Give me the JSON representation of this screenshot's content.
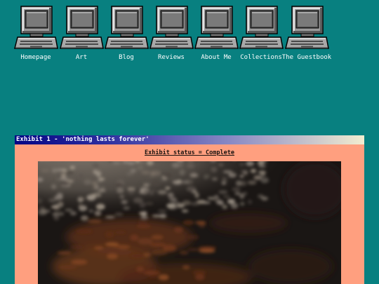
{
  "nav": {
    "items": [
      {
        "label": "Homepage",
        "icon": "computer-icon"
      },
      {
        "label": "Art",
        "icon": "computer-icon"
      },
      {
        "label": "Blog",
        "icon": "computer-icon"
      },
      {
        "label": "Reviews",
        "icon": "computer-icon"
      },
      {
        "label": "About Me",
        "icon": "computer-icon"
      },
      {
        "label": "Collections",
        "icon": "computer-icon"
      },
      {
        "label": "The Guestbook",
        "icon": "computer-icon"
      }
    ]
  },
  "exhibit": {
    "title": "Exhibit 1 - 'nothing lasts forever'",
    "status": "Exhibit status = Complete",
    "image_alt": "dark painting of a stormy sky"
  },
  "colors": {
    "background": "#088080",
    "window": "#ff9f7f",
    "titlebar_start": "#040484",
    "titlebar_end": "#f2edd0"
  }
}
